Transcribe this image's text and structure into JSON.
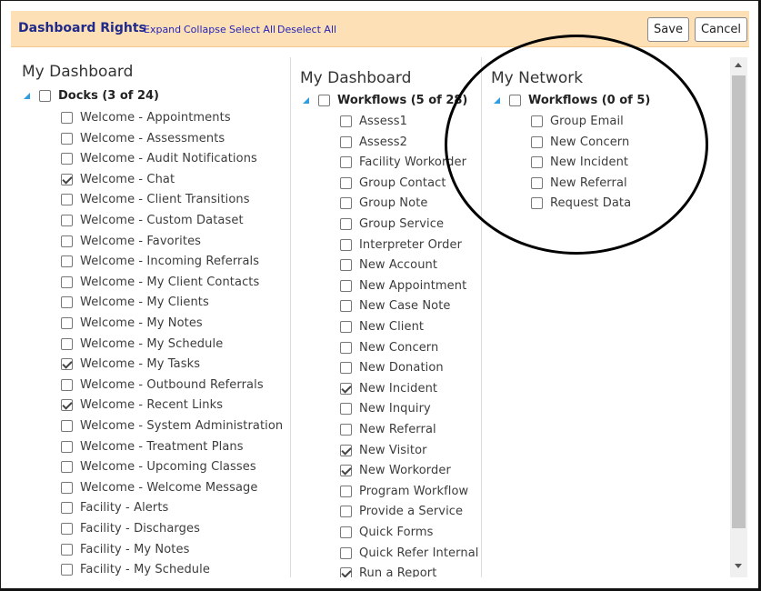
{
  "header": {
    "title": "Dashboard Rights",
    "expand_label": "Expand",
    "collapse_label": "Collapse",
    "select_all_label": "Select All",
    "deselect_all_label": "Deselect All",
    "save_label": "Save",
    "cancel_label": "Cancel"
  },
  "columns": [
    {
      "title": "My Dashboard",
      "group_label": "Docks (3 of 24)",
      "items": [
        {
          "label": "Welcome - Appointments",
          "checked": false
        },
        {
          "label": "Welcome - Assessments",
          "checked": false
        },
        {
          "label": "Welcome - Audit Notifications",
          "checked": false
        },
        {
          "label": "Welcome - Chat",
          "checked": true
        },
        {
          "label": "Welcome - Client Transitions",
          "checked": false
        },
        {
          "label": "Welcome - Custom Dataset",
          "checked": false
        },
        {
          "label": "Welcome - Favorites",
          "checked": false
        },
        {
          "label": "Welcome - Incoming Referrals",
          "checked": false
        },
        {
          "label": "Welcome - My Client Contacts",
          "checked": false
        },
        {
          "label": "Welcome - My Clients",
          "checked": false
        },
        {
          "label": "Welcome - My Notes",
          "checked": false
        },
        {
          "label": "Welcome - My Schedule",
          "checked": false
        },
        {
          "label": "Welcome - My Tasks",
          "checked": true
        },
        {
          "label": "Welcome - Outbound Referrals",
          "checked": false
        },
        {
          "label": "Welcome - Recent Links",
          "checked": true
        },
        {
          "label": "Welcome - System Administration",
          "checked": false
        },
        {
          "label": "Welcome - Treatment Plans",
          "checked": false
        },
        {
          "label": "Welcome - Upcoming Classes",
          "checked": false
        },
        {
          "label": "Welcome - Welcome Message",
          "checked": false
        },
        {
          "label": "Facility - Alerts",
          "checked": false
        },
        {
          "label": "Facility - Discharges",
          "checked": false
        },
        {
          "label": "Facility - My Notes",
          "checked": false
        },
        {
          "label": "Facility - My Schedule",
          "checked": false
        }
      ]
    },
    {
      "title": "My Dashboard",
      "group_label": "Workflows (5 of 28)",
      "items": [
        {
          "label": "Assess1",
          "checked": false
        },
        {
          "label": "Assess2",
          "checked": false
        },
        {
          "label": "Facility Workorder",
          "checked": false
        },
        {
          "label": "Group Contact",
          "checked": false
        },
        {
          "label": "Group Note",
          "checked": false
        },
        {
          "label": "Group Service",
          "checked": false
        },
        {
          "label": "Interpreter Order",
          "checked": false
        },
        {
          "label": "New Account",
          "checked": false
        },
        {
          "label": "New Appointment",
          "checked": false
        },
        {
          "label": "New Case Note",
          "checked": false
        },
        {
          "label": "New Client",
          "checked": false
        },
        {
          "label": "New Concern",
          "checked": false
        },
        {
          "label": "New Donation",
          "checked": false
        },
        {
          "label": "New Incident",
          "checked": true
        },
        {
          "label": "New Inquiry",
          "checked": false
        },
        {
          "label": "New Referral",
          "checked": false
        },
        {
          "label": "New Visitor",
          "checked": true
        },
        {
          "label": "New Workorder",
          "checked": true
        },
        {
          "label": "Program Workflow",
          "checked": false
        },
        {
          "label": "Provide a Service",
          "checked": false
        },
        {
          "label": "Quick Forms",
          "checked": false
        },
        {
          "label": "Quick Refer Internal",
          "checked": false
        },
        {
          "label": "Run a Report",
          "checked": true
        }
      ]
    },
    {
      "title": "My Network",
      "group_label": "Workflows (0 of 5)",
      "items": [
        {
          "label": "Group Email",
          "checked": false
        },
        {
          "label": "New Concern",
          "checked": false
        },
        {
          "label": "New Incident",
          "checked": false
        },
        {
          "label": "New Referral",
          "checked": false
        },
        {
          "label": "Request Data",
          "checked": false
        }
      ]
    }
  ]
}
